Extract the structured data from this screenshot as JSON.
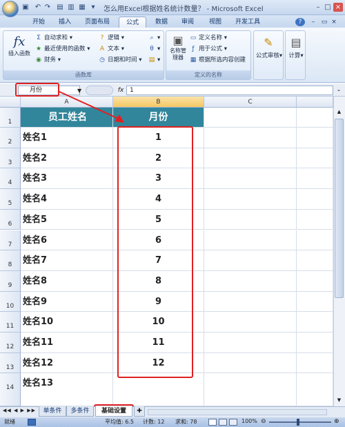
{
  "window": {
    "title": "怎么用Excel根据姓名统计数量？ - Microsoft Excel"
  },
  "tabs": [
    "开始",
    "插入",
    "页面布局",
    "公式",
    "数据",
    "审阅",
    "视图",
    "开发工具"
  ],
  "active_tab": "公式",
  "ribbon": {
    "function_library": {
      "insert_function": "插入函数",
      "autosum": "自动求和",
      "recent": "最近使用的函数",
      "finance": "财务",
      "logical": "逻辑",
      "text": "文本",
      "datetime": "日期和时间",
      "label": "函数库"
    },
    "defined_names": {
      "name_manager": "名称管理器",
      "define_name": "定义名称",
      "use_in_formula": "用于公式",
      "create_from_selection": "根据所选内容创建",
      "label": "定义的名称"
    },
    "formula_auditing": {
      "label": "公式审核"
    },
    "calculation": {
      "label": "计算"
    }
  },
  "formula_bar": {
    "name_box": "月份",
    "fx": "fx",
    "value": "1"
  },
  "columns": [
    "A",
    "B",
    "C"
  ],
  "rows": [
    {
      "num": "1",
      "a": "员工姓名",
      "b": "月份"
    },
    {
      "num": "2",
      "a": "姓名1",
      "b": "1"
    },
    {
      "num": "3",
      "a": "姓名2",
      "b": "2"
    },
    {
      "num": "4",
      "a": "姓名3",
      "b": "3"
    },
    {
      "num": "5",
      "a": "姓名4",
      "b": "4"
    },
    {
      "num": "6",
      "a": "姓名5",
      "b": "5"
    },
    {
      "num": "7",
      "a": "姓名6",
      "b": "6"
    },
    {
      "num": "8",
      "a": "姓名7",
      "b": "7"
    },
    {
      "num": "9",
      "a": "姓名8",
      "b": "8"
    },
    {
      "num": "10",
      "a": "姓名9",
      "b": "9"
    },
    {
      "num": "11",
      "a": "姓名10",
      "b": "10"
    },
    {
      "num": "12",
      "a": "姓名11",
      "b": "11"
    },
    {
      "num": "13",
      "a": "姓名12",
      "b": "12"
    },
    {
      "num": "14",
      "a": "姓名13",
      "b": ""
    }
  ],
  "sheets": [
    "单条件",
    "多条件",
    "基础设置"
  ],
  "active_sheet": "基础设置",
  "status": {
    "ready": "就绪",
    "average": "平均值: 6.5",
    "count": "计数: 12",
    "sum": "求和: 78",
    "zoom": "100%"
  },
  "colors": {
    "header_fill": "#31869b",
    "highlight": "#e02020"
  }
}
